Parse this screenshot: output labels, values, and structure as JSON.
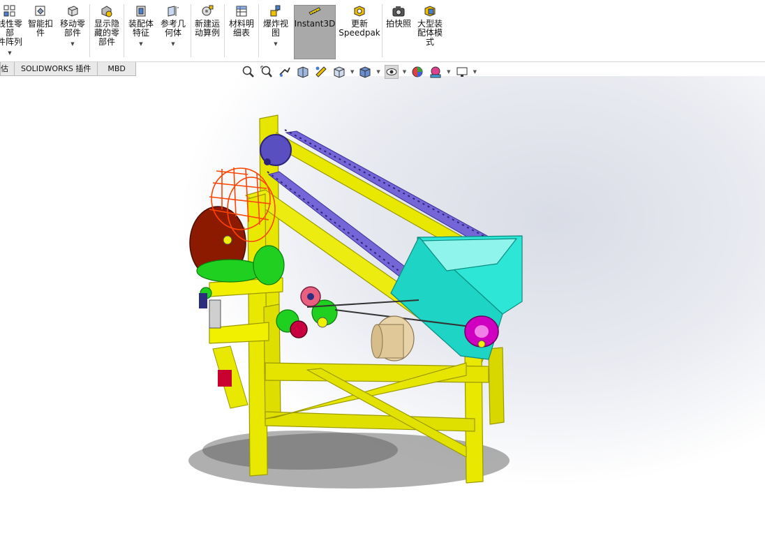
{
  "ribbon": {
    "buttons": [
      {
        "label": "线性零部\n件阵列",
        "icon": "linear-pattern-icon"
      },
      {
        "label": "智能扣\n件",
        "icon": "smart-fasteners-icon"
      },
      {
        "label": "移动零\n部件",
        "icon": "move-component-icon"
      },
      {
        "label": "显示隐\n藏的零\n部件",
        "icon": "show-hidden-components-icon"
      },
      {
        "label": "装配体\n特征",
        "icon": "assembly-features-icon"
      },
      {
        "label": "参考几\n何体",
        "icon": "reference-geometry-icon"
      },
      {
        "label": "新建运\n动算例",
        "icon": "new-motion-study-icon"
      },
      {
        "label": "材料明\n细表",
        "icon": "bill-of-materials-icon"
      },
      {
        "label": "爆炸视\n图",
        "icon": "exploded-view-icon"
      },
      {
        "label": "Instant3D",
        "icon": "instant3d-icon"
      },
      {
        "label": "更新\nSpeedpak",
        "icon": "update-speedpak-icon"
      },
      {
        "label": "拍快照",
        "icon": "take-snapshot-icon"
      },
      {
        "label": "大型装\n配体模\n式",
        "icon": "large-assembly-mode-icon"
      }
    ]
  },
  "tabs": [
    "估",
    "SOLIDWORKS 插件",
    "MBD"
  ],
  "view_toolbar": [
    "zoom-to-fit-icon",
    "zoom-to-area-icon",
    "previous-view-icon",
    "section-view-icon",
    "dynamic-annotation-icon",
    "view-orientation-icon",
    "display-style-icon",
    "hide-show-items-icon",
    "edit-appearance-icon",
    "apply-scene-icon",
    "view-settings-icon"
  ],
  "colors": {
    "frame": "#e8e800",
    "frame_dark": "#9a9a00",
    "hopper": "#28e8d8",
    "chain": "#6a5acd",
    "drum": "#8b1a00",
    "cage": "#ff4400",
    "gears_green": "#20d020",
    "pulley_magenta": "#d000c0",
    "motor": "#e8d2a8"
  }
}
